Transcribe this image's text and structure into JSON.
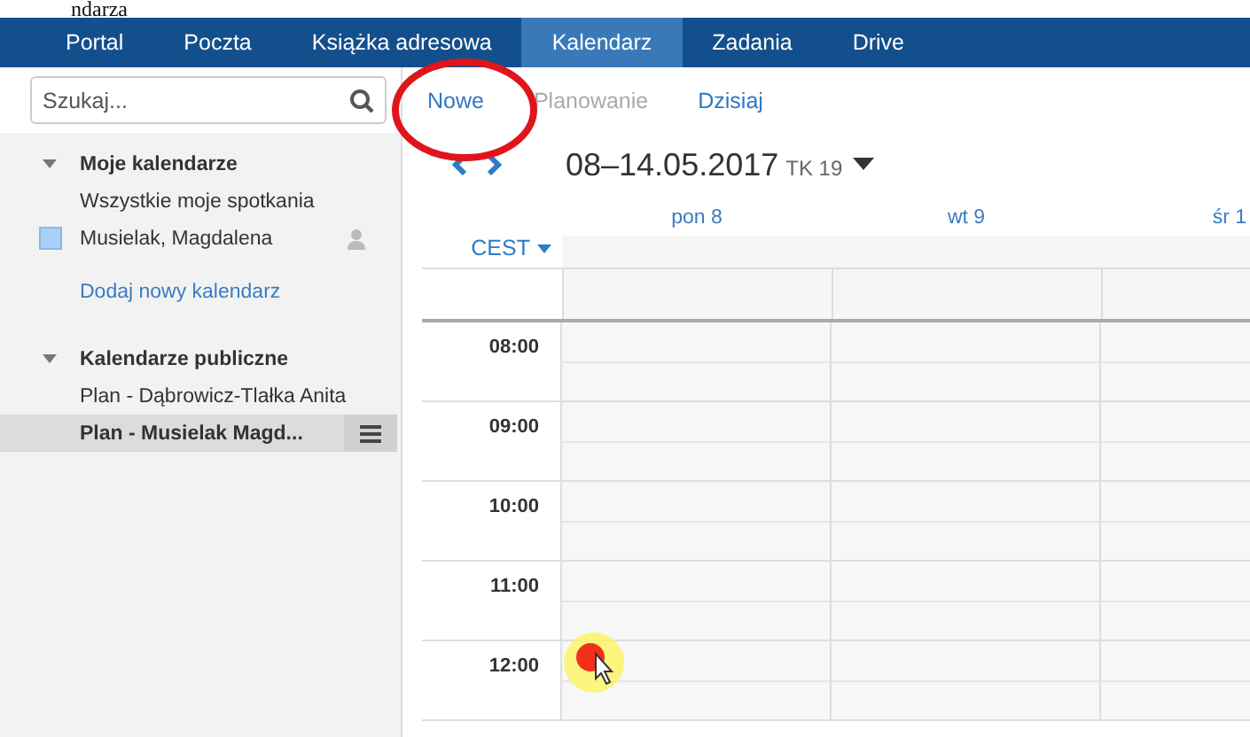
{
  "fragment": "ndarza",
  "nav": {
    "tabs": [
      {
        "label": "Portal",
        "selected": false
      },
      {
        "label": "Poczta",
        "selected": false
      },
      {
        "label": "Książka adresowa",
        "selected": false
      },
      {
        "label": "Kalendarz",
        "selected": true
      },
      {
        "label": "Zadania",
        "selected": false
      },
      {
        "label": "Drive",
        "selected": false
      }
    ]
  },
  "search": {
    "placeholder": "Szukaj..."
  },
  "toolbar": {
    "buttons": [
      {
        "label": "Nowe",
        "disabled": false
      },
      {
        "label": "Planowanie",
        "disabled": true
      },
      {
        "label": "Dzisiaj",
        "disabled": false
      }
    ]
  },
  "sidebar": {
    "sections": [
      {
        "title": "Moje kalendarze",
        "expanded": true,
        "items": [
          {
            "label": "Wszystkie moje spotkania",
            "kind": "plain",
            "selected": false
          },
          {
            "label": "Musielak, Magdalena",
            "kind": "calendar",
            "color": "#a8d0fb",
            "selected": false
          }
        ],
        "link": "Dodaj nowy kalendarz"
      },
      {
        "title": "Kalendarze publiczne",
        "expanded": true,
        "items": [
          {
            "label": "Plan - Dąbrowicz-Tlałka Anita",
            "kind": "plain",
            "selected": false
          },
          {
            "label": "Plan - Musielak Magd...",
            "kind": "plain",
            "selected": true
          }
        ]
      }
    ]
  },
  "calendar": {
    "range": "08–14.05.2017",
    "week": "TK 19",
    "timezone": "CEST",
    "days": [
      "pon 8",
      "wt 9",
      "śr 1"
    ],
    "hours": [
      "08:00",
      "09:00",
      "10:00",
      "11:00",
      "12:00"
    ]
  }
}
